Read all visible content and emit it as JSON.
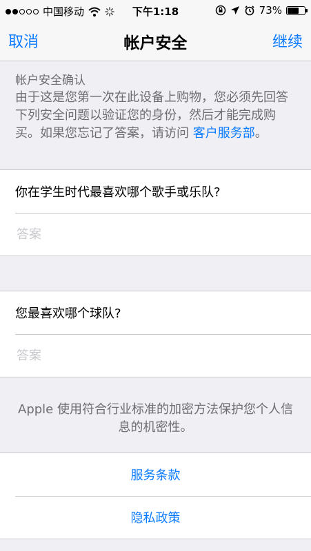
{
  "status_bar": {
    "signal_filled": 2,
    "signal_total": 5,
    "carrier": "中国移动",
    "time": "下午1:18",
    "battery": "73%",
    "battery_level": 0.73,
    "icons": [
      "wifi-icon",
      "loading-icon",
      "orientation-lock-icon",
      "location-icon",
      "alarm-icon",
      "battery-icon"
    ]
  },
  "nav": {
    "left": "取消",
    "title": "帐户安全",
    "right": "继续"
  },
  "intro": {
    "title": "帐户安全确认",
    "body": "由于这是您第一次在此设备上购物，您必须先回答下列安全问题以验证您的身份，然后才能完成购买。如果您忘记了答案，请访问 ",
    "link": "客户服务部",
    "suffix": "。"
  },
  "questions": [
    {
      "question": "你在学生时代最喜欢哪个歌手或乐队?",
      "answer": "",
      "placeholder": "答案"
    },
    {
      "question": "您最喜欢哪个球队?",
      "answer": "",
      "placeholder": "答案"
    }
  ],
  "footer": {
    "note": "Apple 使用符合行业标准的加密方法保护您个人信息的机密性。",
    "links": [
      "服务条款",
      "隐私政策"
    ]
  },
  "colors": {
    "accent": "#0a7aff",
    "background": "#efeff4",
    "secondary_text": "#6d6d72",
    "placeholder": "#c7c7cd",
    "separator": "#c8c7cc"
  }
}
